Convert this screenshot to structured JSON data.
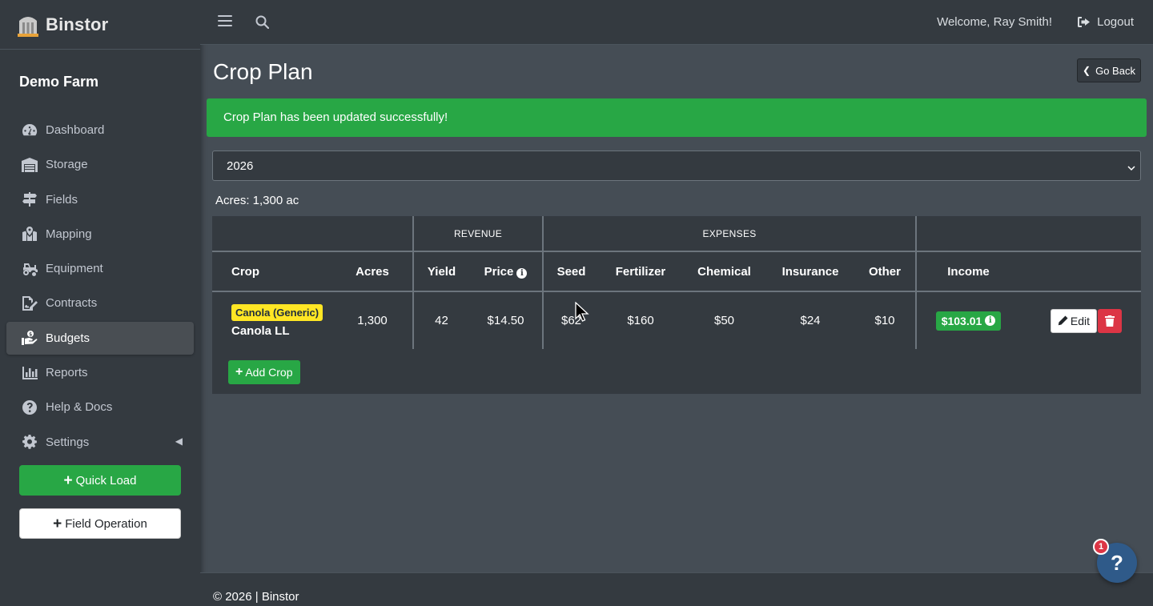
{
  "app": {
    "brand": "Binstor",
    "farm_name": "Demo Farm"
  },
  "topbar": {
    "welcome": "Welcome, Ray Smith!",
    "logout_label": "Logout"
  },
  "sidebar": {
    "items": [
      {
        "label": "Dashboard",
        "icon": "dashboard-icon"
      },
      {
        "label": "Storage",
        "icon": "warehouse-icon"
      },
      {
        "label": "Fields",
        "icon": "signpost-icon"
      },
      {
        "label": "Mapping",
        "icon": "map-marked-icon"
      },
      {
        "label": "Equipment",
        "icon": "tractor-icon"
      },
      {
        "label": "Contracts",
        "icon": "file-signature-icon"
      },
      {
        "label": "Budgets",
        "icon": "budget-hand-icon",
        "active": true
      },
      {
        "label": "Reports",
        "icon": "chart-bar-icon"
      },
      {
        "label": "Help & Docs",
        "icon": "question-circle-icon"
      },
      {
        "label": "Settings",
        "icon": "gear-icon"
      }
    ],
    "quick_load_label": "Quick Load",
    "field_operation_label": "Field Operation"
  },
  "page": {
    "title": "Crop Plan",
    "go_back_label": "Go Back",
    "alert": "Crop Plan has been updated successfully!",
    "year_selected": "2026",
    "acres_summary": "Acres: 1,300 ac"
  },
  "table": {
    "groups": {
      "revenue": "REVENUE",
      "expenses": "EXPENSES"
    },
    "headers": {
      "crop": "Crop",
      "acres": "Acres",
      "yield": "Yield",
      "price": "Price",
      "seed": "Seed",
      "fertilizer": "Fertilizer",
      "chemical": "Chemical",
      "insurance": "Insurance",
      "other": "Other",
      "income": "Income"
    },
    "rows": [
      {
        "crop_badge": "Canola (Generic)",
        "crop_name": "Canola LL",
        "acres": "1,300",
        "yield": "42",
        "price": "$14.50",
        "seed": "$62",
        "fertilizer": "$160",
        "chemical": "$50",
        "insurance": "$24",
        "other": "$10",
        "income": "$103.01",
        "edit_label": "Edit"
      }
    ],
    "add_crop_label": "Add Crop"
  },
  "footer": {
    "text": "© 2026 | Binstor"
  },
  "help": {
    "label": "?",
    "badge_count": "1"
  },
  "colors": {
    "success": "#28a745",
    "danger": "#dc3545",
    "warning": "#ffe624",
    "sidebar_bg": "#343a40",
    "content_bg": "#454d55"
  }
}
